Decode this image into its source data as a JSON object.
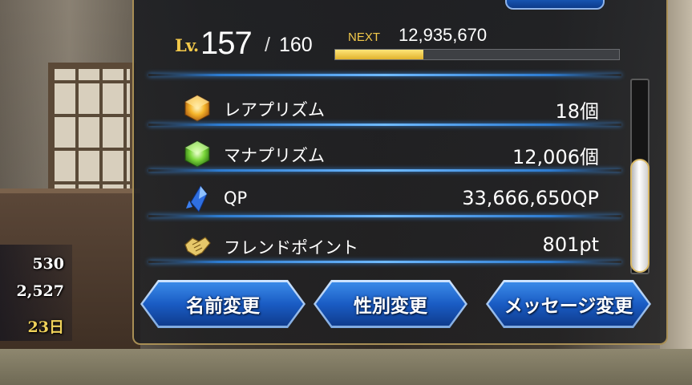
{
  "level": {
    "prefix": "Lv.",
    "current": "157",
    "separator": "/",
    "max": "160",
    "next_label": "NEXT",
    "next_exp": "12,935,670",
    "exp_progress": 0.31
  },
  "items": [
    {
      "name": "レアプリズム",
      "value": "18個",
      "icon": "rare-prism-icon"
    },
    {
      "name": "マナプリズム",
      "value": "12,006個",
      "icon": "mana-prism-icon"
    },
    {
      "name": "QP",
      "value": "33,666,650QP",
      "icon": "qp-crystal-icon"
    },
    {
      "name": "フレンドポイント",
      "value": "801pt",
      "icon": "friend-point-icon"
    }
  ],
  "buttons": {
    "rename": "名前変更",
    "gender": "性別変更",
    "message": "メッセージ変更"
  },
  "side_counters": [
    "530",
    "2,527",
    "23日"
  ],
  "colors": {
    "accent_gold": "#f3c94a",
    "button_blue": "#1a5cc4",
    "divider_blue": "#6fbaff"
  }
}
